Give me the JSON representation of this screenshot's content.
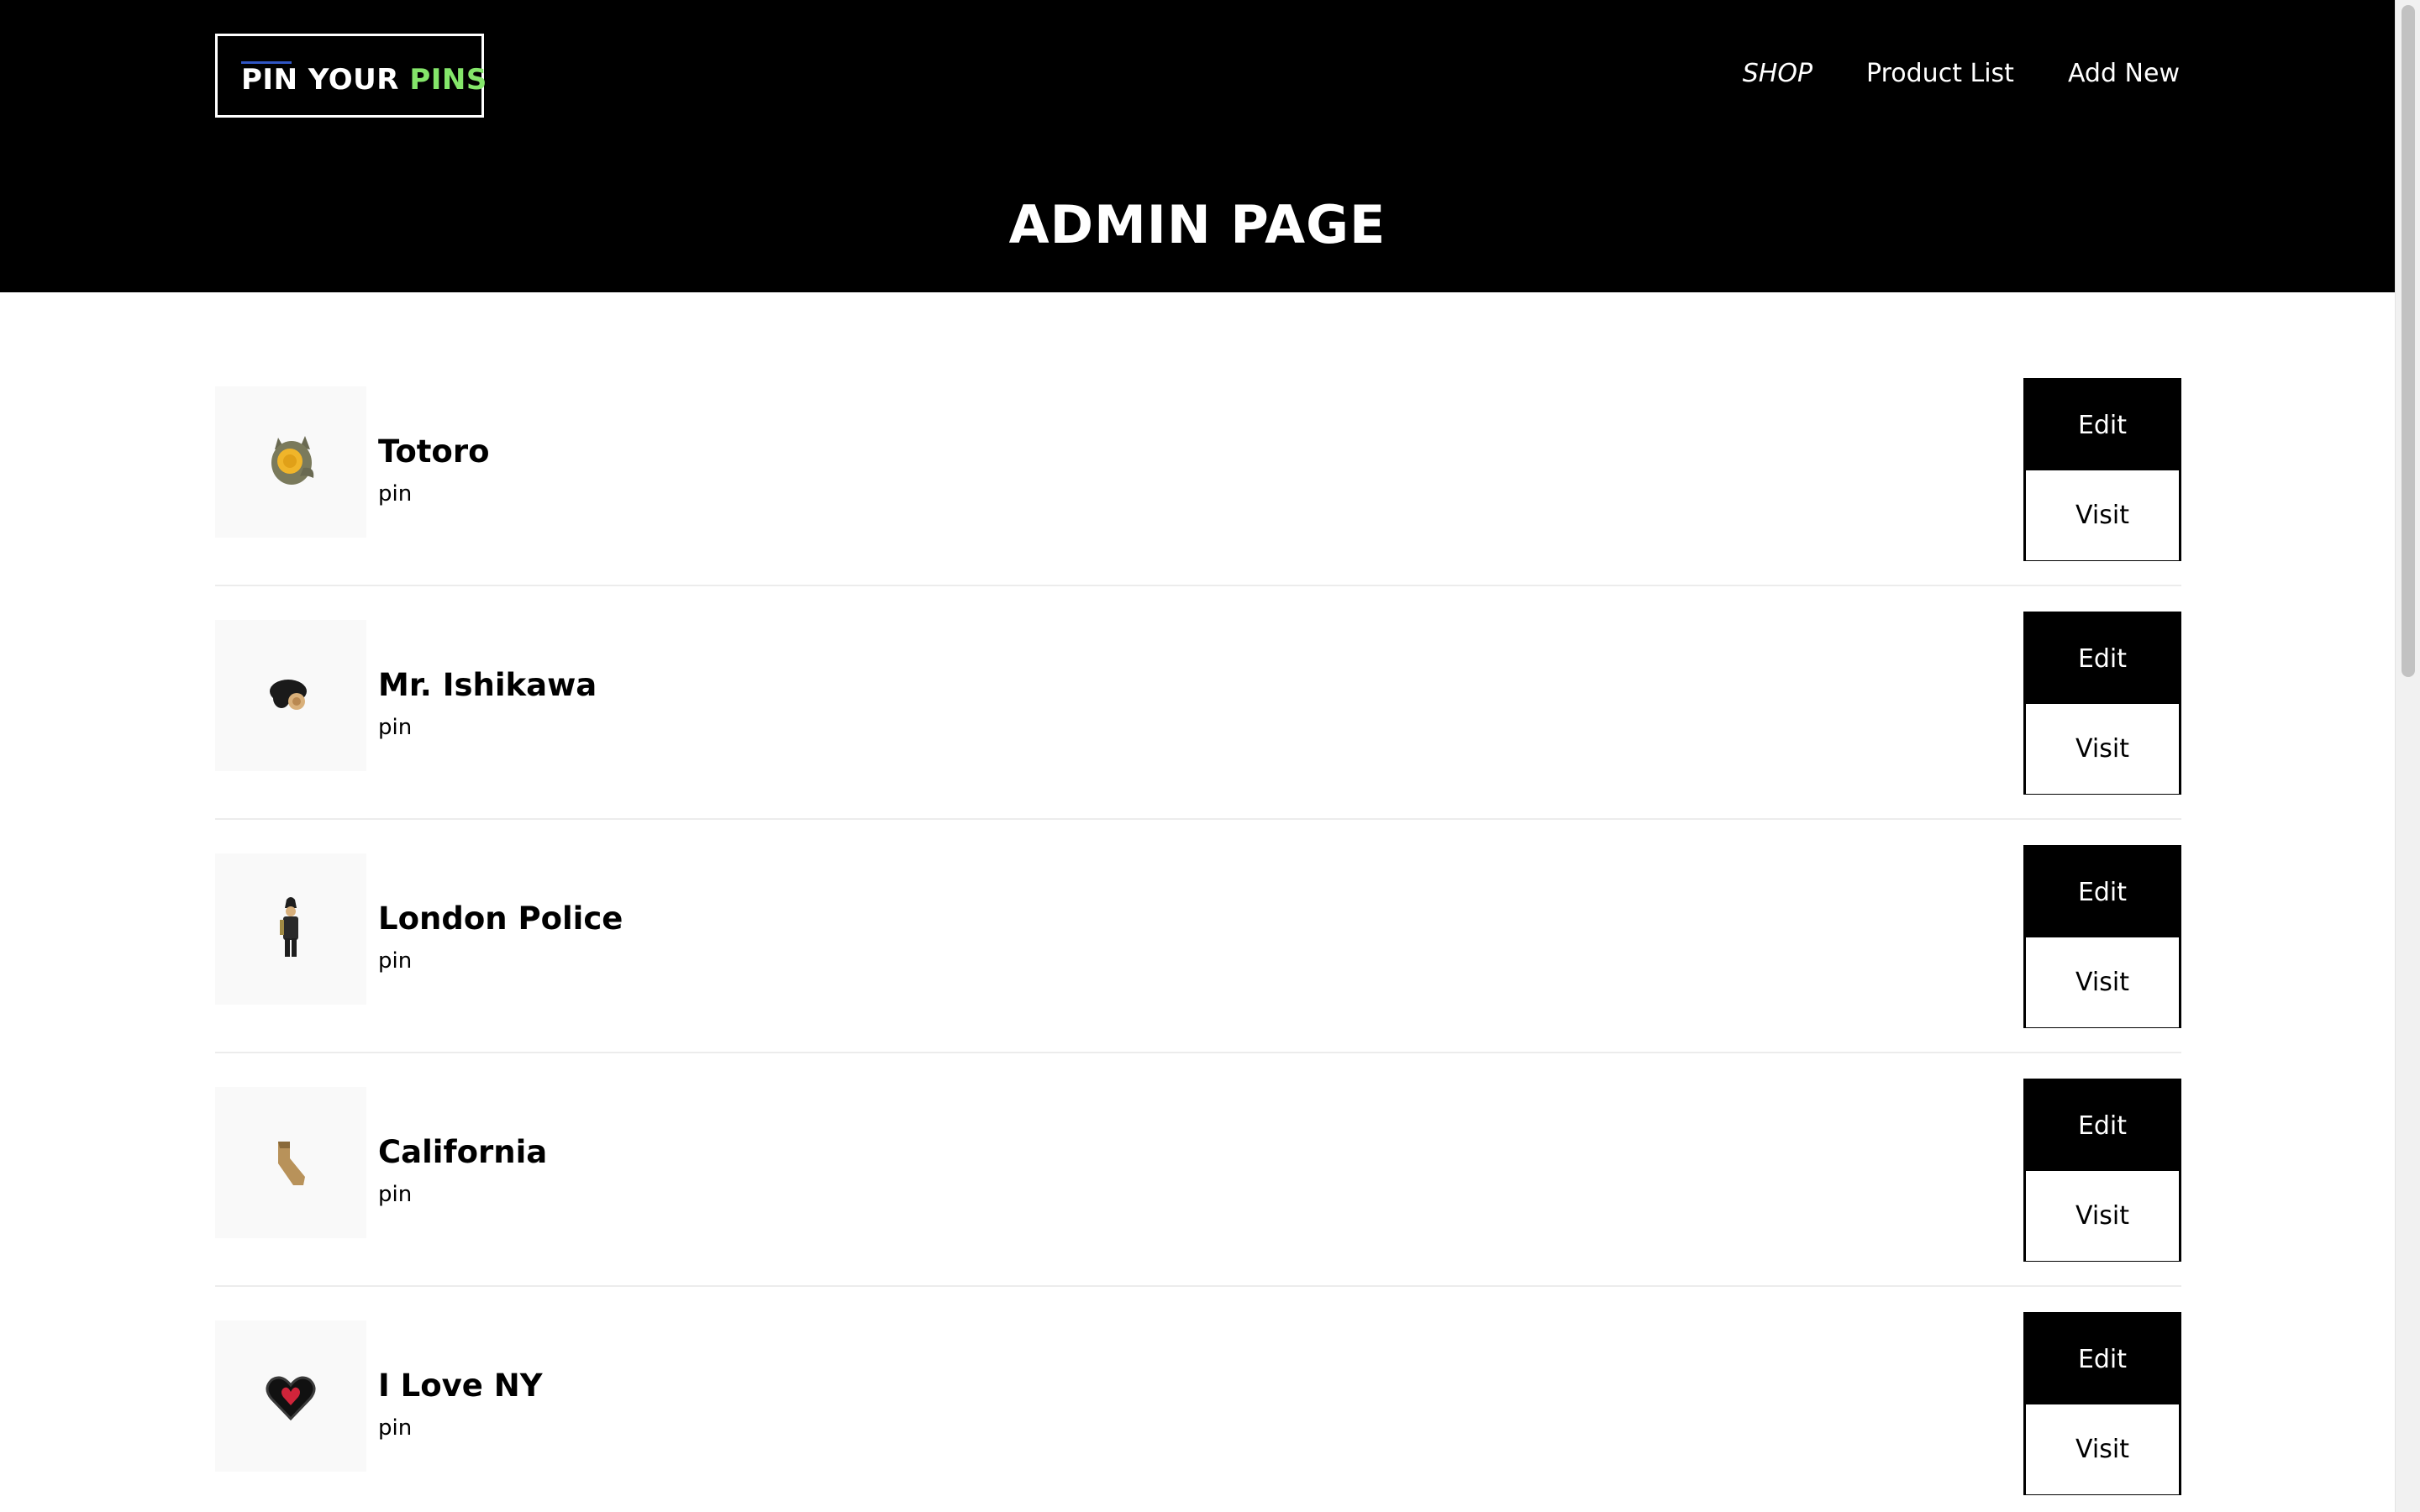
{
  "logo": {
    "part1": "PIN YOUR ",
    "part2": "PINS"
  },
  "nav": {
    "shop": "SHOP",
    "product_list": "Product List",
    "add_new": "Add New"
  },
  "page_title": "ADMIN PAGE",
  "products": [
    {
      "name": "Totoro",
      "type": "pin",
      "icon": "totoro-pin-icon",
      "edit_label": "Edit",
      "visit_label": "Visit"
    },
    {
      "name": "Mr. Ishikawa",
      "type": "pin",
      "icon": "ishikawa-pin-icon",
      "edit_label": "Edit",
      "visit_label": "Visit"
    },
    {
      "name": "London Police",
      "type": "pin",
      "icon": "london-police-pin-icon",
      "edit_label": "Edit",
      "visit_label": "Visit"
    },
    {
      "name": "California",
      "type": "pin",
      "icon": "california-pin-icon",
      "edit_label": "Edit",
      "visit_label": "Visit"
    },
    {
      "name": "I Love NY",
      "type": "pin",
      "icon": "heart-ny-pin-icon",
      "edit_label": "Edit",
      "visit_label": "Visit"
    }
  ],
  "colors": {
    "header_bg": "#000000",
    "logo_accent": "#84e66a",
    "edit_bg": "#000000",
    "visit_bg": "#ffffff"
  }
}
